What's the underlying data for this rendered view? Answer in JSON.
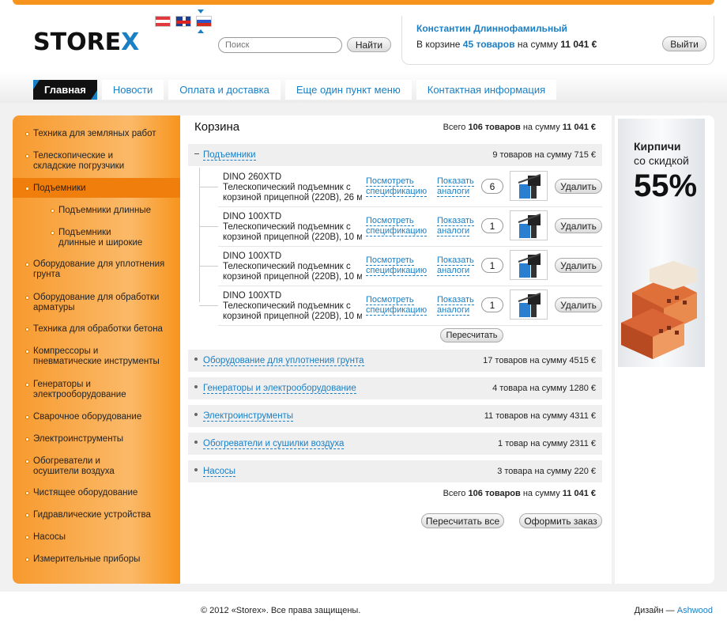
{
  "header": {
    "logo_main": "STORE",
    "logo_accent": "X",
    "search_placeholder": "Поиск",
    "search_button": "Найти"
  },
  "user": {
    "name": "Константин Длиннофамильный",
    "cart_prefix": "В корзине",
    "cart_count": "45 товаров",
    "cart_mid": "на сумму",
    "cart_sum": "11 041 €",
    "logout_button": "Выйти"
  },
  "nav": [
    "Главная",
    "Новости",
    "Оплата и доставка",
    "Еще один пункт меню",
    "Контактная информация"
  ],
  "sidebar": [
    {
      "label": "Техника для земляных работ",
      "level": 0
    },
    {
      "label": "Телескопические и складские погрузчики",
      "level": 0
    },
    {
      "label": "Подъемники",
      "level": 0,
      "active": true
    },
    {
      "label": "Подъемники длинные",
      "level": 1
    },
    {
      "label": "Подъемники длинные и широкие",
      "level": 1
    },
    {
      "label": "Оборудование для уплотнения грунта",
      "level": 0
    },
    {
      "label": "Оборудование для обработки арматуры",
      "level": 0
    },
    {
      "label": "Техника для обработки бетона",
      "level": 0
    },
    {
      "label": "Компрессоры и пневматические инструменты",
      "level": 0
    },
    {
      "label": "Генераторы и электрооборудование",
      "level": 0
    },
    {
      "label": "Сварочное оборудование",
      "level": 0
    },
    {
      "label": "Электроинструменты",
      "level": 0
    },
    {
      "label": "Обогреватели и осушители воздуха",
      "level": 0
    },
    {
      "label": "Чистящее оборудование",
      "level": 0
    },
    {
      "label": "Гидравлические устройства",
      "level": 0
    },
    {
      "label": "Насосы",
      "level": 0
    },
    {
      "label": "Измерительные приборы",
      "level": 0
    }
  ],
  "cart": {
    "title": "Корзина",
    "total_prefix": "Всего",
    "total_count": "106 товаров",
    "total_mid": "на сумму",
    "total_sum": "11 041 €",
    "open_group": {
      "name": "Подъемники",
      "summary": "9 товаров на сумму 715 €"
    },
    "items": [
      {
        "model": "DINO 260XTD",
        "desc1": "Телескопический подъемник с",
        "desc2": "корзиной прицепной (220В), 26 м",
        "qty": "6"
      },
      {
        "model": "DINO 100XTD",
        "desc1": "Телескопический подъемник с",
        "desc2": "корзиной прицепной (220В), 10 м",
        "qty": "1"
      },
      {
        "model": "DINO 100XTD",
        "desc1": "Телескопический подъемник с",
        "desc2": "корзиной прицепной (220В), 10 м",
        "qty": "1"
      },
      {
        "model": "DINO 100XTD",
        "desc1": "Телескопический подъемник с",
        "desc2": "корзиной прицепной (220В), 10 м",
        "qty": "1"
      }
    ],
    "spec_link1": "Посмотреть",
    "spec_link2": "спецификацию",
    "analog_link1": "Показать",
    "analog_link2": "аналоги",
    "delete_button": "Удалить",
    "recalc_button": "Пересчитать",
    "groups": [
      {
        "name": "Оборудование для уплотнения грунта",
        "summary": "17 товаров на сумму 4515 €"
      },
      {
        "name": "Генераторы и электрооборудование",
        "summary": "4 товара на сумму 1280 €"
      },
      {
        "name": "Электроинструменты",
        "summary": "11 товаров на сумму 4311 €"
      },
      {
        "name": "Обогреватели и сушилки воздуха",
        "summary": "1 товар на сумму 2311 €"
      },
      {
        "name": "Насосы",
        "summary": "3 товара на сумму 220 €"
      }
    ],
    "recalc_all_button": "Пересчитать все",
    "order_button": "Оформить заказ"
  },
  "banner": {
    "line1": "Кирпичи",
    "line2": "со скидкой",
    "discount": "55%"
  },
  "footer": {
    "copyright": "© 2012 «Storex». Все права защищены.",
    "design_label": "Дизайн —",
    "design_link": "Ashwood"
  },
  "colors": {
    "accent": "#f7941d",
    "link": "#1a7fc4"
  }
}
